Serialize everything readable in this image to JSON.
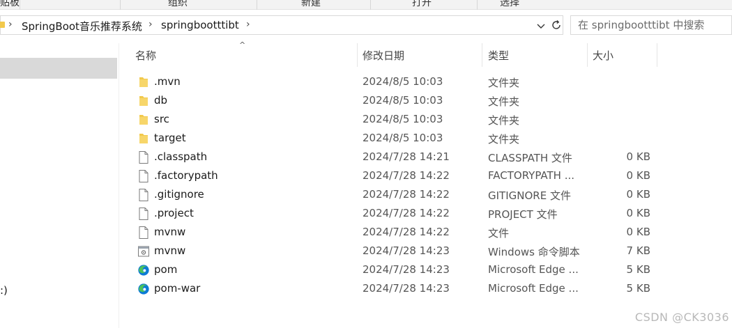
{
  "ribbon": {
    "groups": [
      "贴板",
      "组织",
      "新建",
      "打开",
      "选择"
    ]
  },
  "address": {
    "crumbs": [
      "SpringBoot音乐推荐系统",
      "springbootttibt"
    ],
    "separator_icon": "chevron-right-icon"
  },
  "search": {
    "placeholder": "在 springbootttibt 中搜索"
  },
  "nav": {
    "drive_label": ":)"
  },
  "columns": {
    "name": "名称",
    "date": "修改日期",
    "type": "类型",
    "size": "大小"
  },
  "files": [
    {
      "name": ".mvn",
      "date": "2024/8/5 10:03",
      "type": "文件夹",
      "size": "",
      "icon": "folder-icon"
    },
    {
      "name": "db",
      "date": "2024/8/5 10:03",
      "type": "文件夹",
      "size": "",
      "icon": "folder-icon"
    },
    {
      "name": "src",
      "date": "2024/8/5 10:03",
      "type": "文件夹",
      "size": "",
      "icon": "folder-icon"
    },
    {
      "name": "target",
      "date": "2024/8/5 10:03",
      "type": "文件夹",
      "size": "",
      "icon": "folder-icon"
    },
    {
      "name": ".classpath",
      "date": "2024/7/28 14:21",
      "type": "CLASSPATH 文件",
      "size": "0 KB",
      "icon": "file-icon"
    },
    {
      "name": ".factorypath",
      "date": "2024/7/28 14:22",
      "type": "FACTORYPATH ...",
      "size": "0 KB",
      "icon": "file-icon"
    },
    {
      "name": ".gitignore",
      "date": "2024/7/28 14:22",
      "type": "GITIGNORE 文件",
      "size": "0 KB",
      "icon": "file-icon"
    },
    {
      "name": ".project",
      "date": "2024/7/28 14:22",
      "type": "PROJECT 文件",
      "size": "0 KB",
      "icon": "file-icon"
    },
    {
      "name": "mvnw",
      "date": "2024/7/28 14:22",
      "type": "文件",
      "size": "0 KB",
      "icon": "file-icon"
    },
    {
      "name": "mvnw",
      "date": "2024/7/28 14:23",
      "type": "Windows 命令脚本",
      "size": "7 KB",
      "icon": "script-icon"
    },
    {
      "name": "pom",
      "date": "2024/7/28 14:23",
      "type": "Microsoft Edge ...",
      "size": "5 KB",
      "icon": "edge-icon"
    },
    {
      "name": "pom-war",
      "date": "2024/7/28 14:23",
      "type": "Microsoft Edge ...",
      "size": "5 KB",
      "icon": "edge-icon"
    }
  ],
  "watermark": "CSDN @CK3036",
  "colors": {
    "folder": "#f2c94c",
    "edge_blue": "#0c7ad6",
    "edge_green": "#4cc35b",
    "selection": "#d9d9d9"
  }
}
